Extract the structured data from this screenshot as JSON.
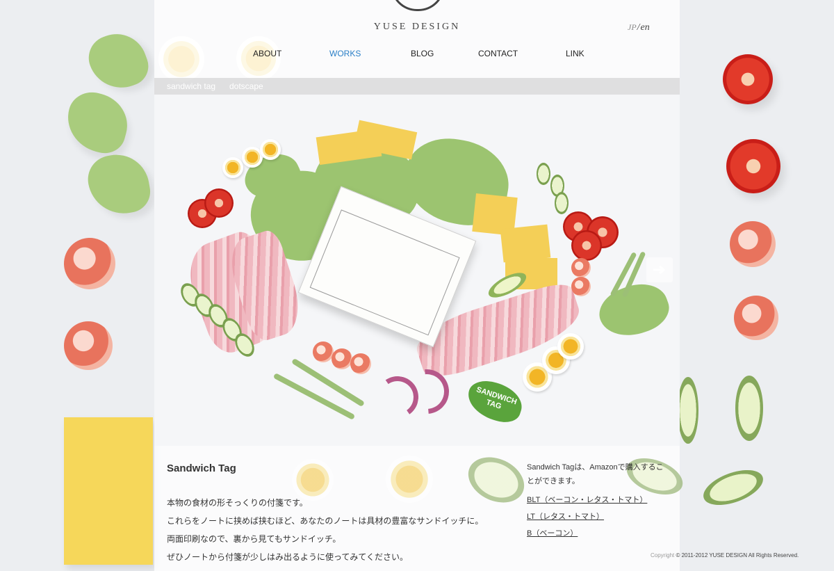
{
  "brand": {
    "name": "YUSE DESIGN"
  },
  "language": {
    "jp": "JP",
    "separator": "/",
    "en": "en"
  },
  "nav": {
    "items": [
      {
        "label": "ABOUT"
      },
      {
        "label": "WORKS"
      },
      {
        "label": "BLOG"
      },
      {
        "label": "CONTACT"
      },
      {
        "label": "LINK"
      }
    ]
  },
  "subnav": {
    "items": [
      {
        "label": "sandwich tag"
      },
      {
        "label": "dotscape"
      }
    ]
  },
  "hero": {
    "badge_text": "SANDWICH TAG",
    "next_icon": "arrow-right-icon"
  },
  "work": {
    "title": "Sandwich Tag",
    "lines": [
      "本物の食材の形そっくりの付箋です。",
      "これらをノートに挟めば挟むほど、あなたのノートは具材の豊富なサンドイッチに。",
      "両面印刷なので、裏から見てもサンドイッチ。",
      "ぜひノートから付箋が少しはみ出るように使ってみてください。"
    ]
  },
  "purchase": {
    "intro": "Sandwich Tagは、Amazonで購入することができます。",
    "links": [
      {
        "label": "BLT（ベーコン・レタス・トマト）"
      },
      {
        "label": "LT（レタス・トマト）"
      },
      {
        "label": "B（ベーコン）"
      }
    ]
  },
  "footer": {
    "copyright_word": "Copyright",
    "rest": "© 2011-2012 YUSE DESIGN All Rights Reserved."
  },
  "colors": {
    "accent": "#2a7fc7",
    "background": "#eceef1"
  }
}
